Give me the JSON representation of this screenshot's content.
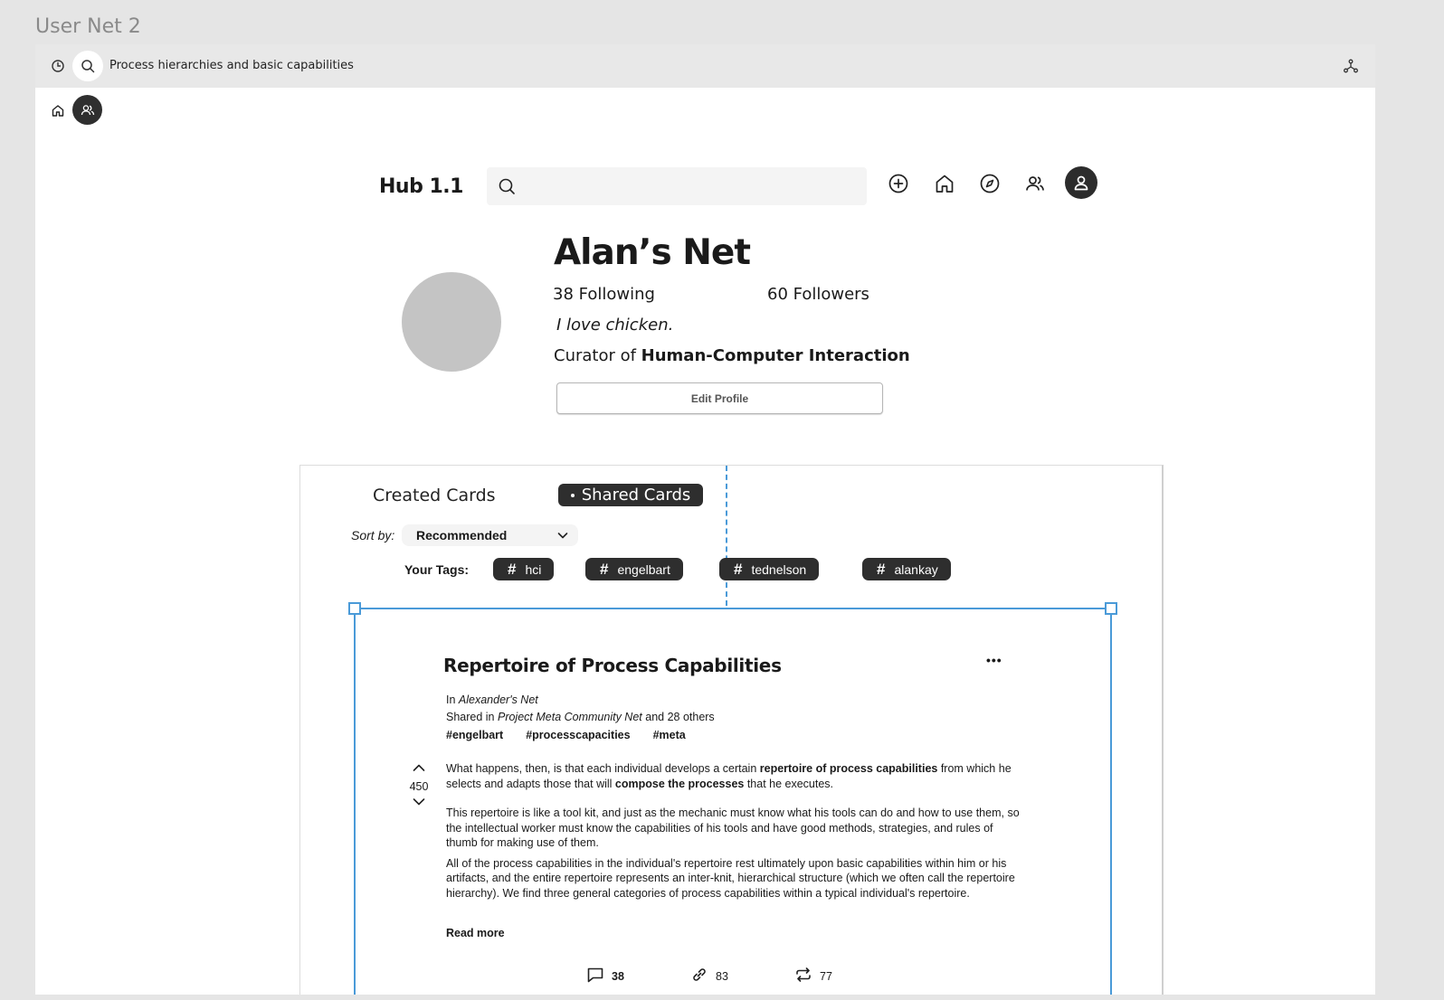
{
  "window": {
    "title": "User Net 2"
  },
  "topbar": {
    "path_text": "Process hierarchies and basic capabilities"
  },
  "hub": {
    "logo": "Hub 1.1"
  },
  "profile": {
    "name": "Alan’s Net",
    "following": "38 Following",
    "followers": "60 Followers",
    "bio": "I love chicken.",
    "curator_prefix": "Curator of ",
    "curator_topic": "Human-Computer Interaction",
    "edit_button": "Edit Profile"
  },
  "tabs": {
    "created": "Created Cards",
    "shared": "Shared Cards"
  },
  "sort": {
    "label": "Sort by:",
    "value": "Recommended"
  },
  "tags": {
    "label": "Your Tags:",
    "items": [
      "hci",
      "engelbart",
      "tednelson",
      "alankay"
    ]
  },
  "card": {
    "title": "Repertoire of Process Capabilities",
    "more": "•••",
    "in_prefix": "In ",
    "in_net": "Alexander's Net",
    "shared_prefix": "Shared in ",
    "shared_net": "Project Meta Community Net",
    "shared_suffix": " and 28 others",
    "hashtags": [
      "#engelbart",
      "#processcapacities",
      "#meta"
    ],
    "votes": "450",
    "p1_a": "What happens, then, is that each individual develops a certain ",
    "p1_b": "repertoire of process capabilities",
    "p1_c": " from which he selects and adapts those that will ",
    "p1_d": "compose the processes",
    "p1_e": " that he executes.",
    "p2": "This repertoire is like a tool kit, and just as the mechanic must know what his tools can do and how to use them, so the intellectual worker must know the capabilities of his tools and have good methods, strategies, and rules of thumb for making use of them.",
    "p3": "All of the process capabilities in the individual's repertoire rest ultimately upon basic capabilities within him or his artifacts, and the entire repertoire represents an inter-knit, hierarchical structure (which we often call the repertoire hierarchy). We find three general categories of process capabilities within a typical individual's repertoire.",
    "read_more": "Read more",
    "comments": "38",
    "links": "83",
    "reposts": "77"
  },
  "colors": {
    "selection": "#4a9ad8",
    "chip": "#2e2e2e"
  }
}
